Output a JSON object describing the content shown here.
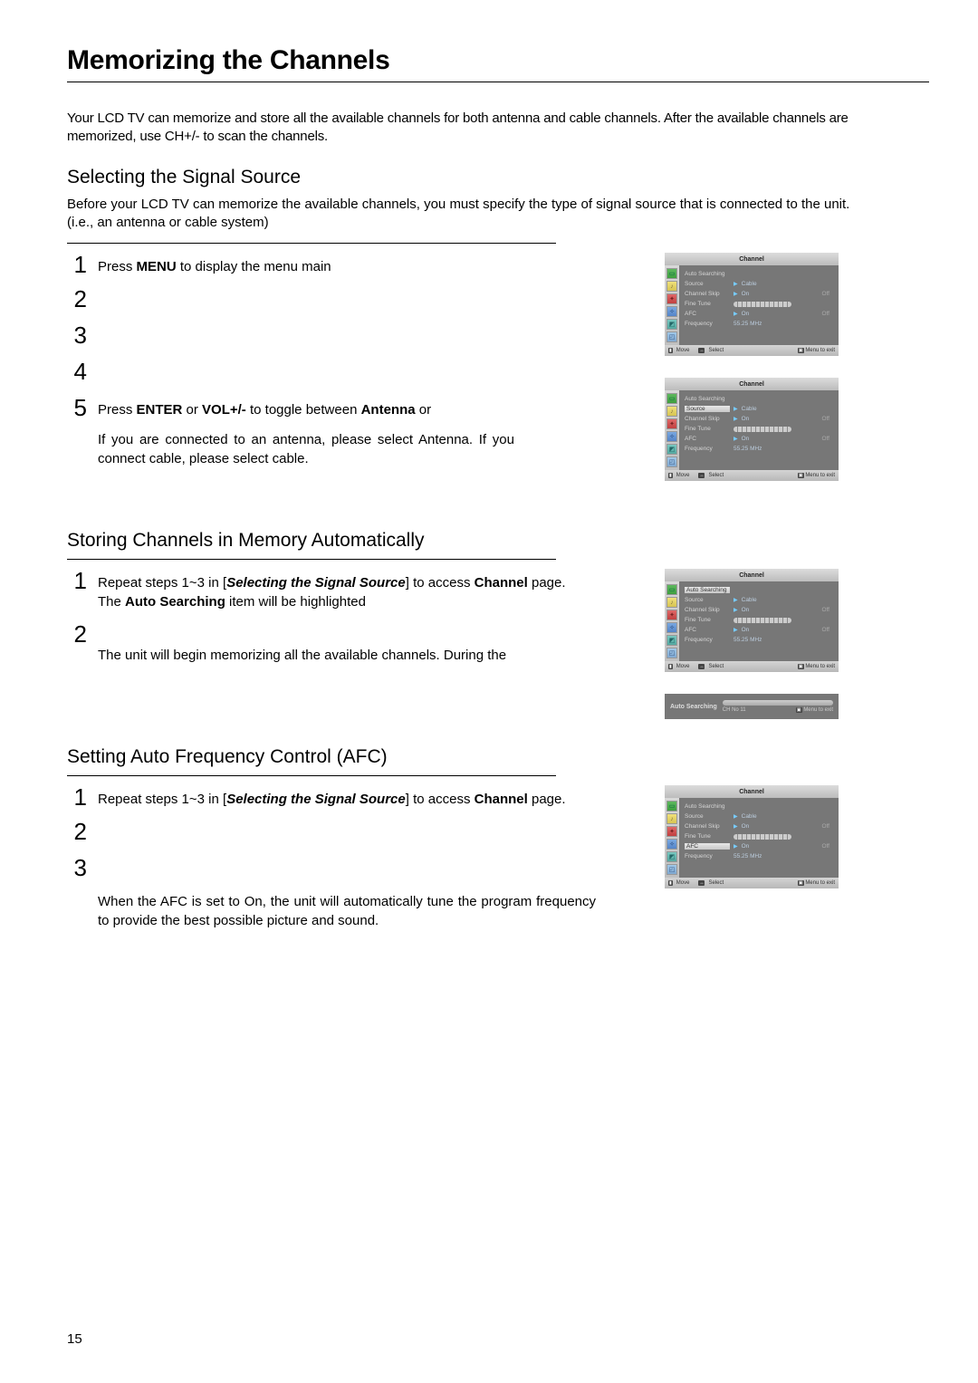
{
  "page_number": "15",
  "title": "Memorizing the Channels",
  "intro": "Your LCD TV can memorize and store all the available channels for both antenna and cable channels. After the  available channels are memorized, use CH+/-  to scan the channels.",
  "sections": {
    "select_source": {
      "heading": "Selecting the Signal Source",
      "intro": "Before your LCD TV can memorize the available channels, you must specify the type of signal  source that is connected to the unit. (i.e., an antenna or cable system)",
      "step1_a": "Press  ",
      "step1_bold": "MENU",
      "step1_b": " to display the menu main",
      "step5_a": "Press ",
      "step5_b1": "ENTER",
      "step5_mid1": " or ",
      "step5_b2": "VOL+/-",
      "step5_mid2": " to toggle between ",
      "step5_b3": "Antenna",
      "step5_end": " or",
      "note": "If you are connected to an antenna, please select Antenna. If you connect cable, please select cable."
    },
    "auto_store": {
      "heading": "Storing Channels in Memory Automatically",
      "step1_a": "Repeat steps 1~3 in [",
      "step1_bi": "Selecting the Signal Source",
      "step1_b": "] to access ",
      "step1_bold": "Channel",
      "step1_c": " page.",
      "step1_line2a": "The ",
      "step1_line2b": "Auto Searching",
      "step1_line2c": " item will be highlighted",
      "step2_line2": "The unit will begin memorizing all the available channels. During the"
    },
    "afc": {
      "heading": "Setting Auto Frequency Control (AFC)",
      "step1_a": "Repeat steps 1~3 in [",
      "step1_bi": "Selecting the Signal Source",
      "step1_b": "] to access ",
      "step1_bold": "Channel",
      "step1_c": " page.",
      "note": "When the AFC is set to On, the unit will automatically tune the program frequency to provide the best possible picture and sound."
    }
  },
  "osd": {
    "title": "Channel",
    "rows": {
      "auto_searching": "Auto Searching",
      "source": "Source",
      "source_val": "Cable",
      "channel_skip": "Channel Skip",
      "on": "On",
      "off": "Off",
      "fine_tune": "Fine Tune",
      "afc": "AFC",
      "frequency": "Frequency",
      "freq_val": "55.25 MHz"
    },
    "footer": {
      "move": "Move",
      "select": "Select",
      "menu": "Menu to exit"
    },
    "mini": {
      "label": "Auto Searching",
      "ch": "CH No  11",
      "menu": "Menu to exit"
    }
  }
}
